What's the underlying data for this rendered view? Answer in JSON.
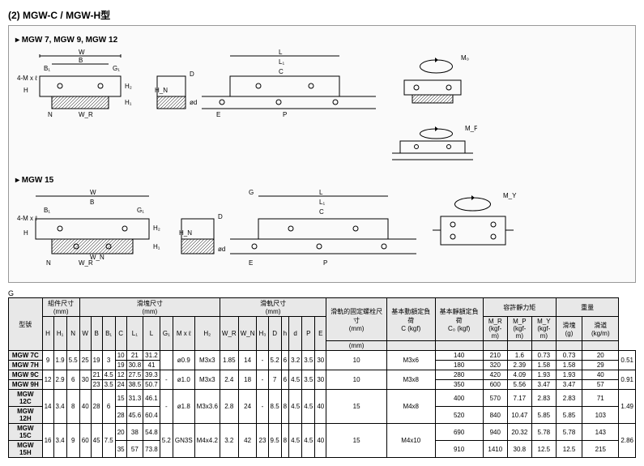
{
  "header": {
    "title": "(2) MGW-C / MGW-H型",
    "subtitle1": "▸ MGW 7, MGW 9, MGW 12",
    "subtitle2": "▸ MGW 15"
  },
  "diagram_labels": {
    "w": "W",
    "b": "B",
    "bp": "B₁",
    "gp": "G₁",
    "h": "H",
    "h2": "H₂",
    "h1": "H₁",
    "n": "N",
    "wr": "W_R",
    "wn": "W_N",
    "mxl": "4-M x ℓ",
    "l": "L",
    "l1": "L₁",
    "c": "C",
    "d": "D",
    "od": "ød",
    "g": "G",
    "hn": "H_N",
    "e": "E",
    "p": "P",
    "mo": "M₀",
    "mp": "M_P",
    "my": "M_Y"
  },
  "table": {
    "head_groups": {
      "model": "型號",
      "assy": "組件尺寸",
      "block": "滑塊尺寸",
      "rail": "滑軌尺寸",
      "bolt": "滑軌的固定螺栓尺寸",
      "dyn": "基本動額定負荷",
      "stat": "基本靜額定負荷",
      "moment": "容許靜力矩",
      "weight": "重量",
      "mm": "(mm)",
      "kgf": "(kgf)",
      "kgfm": "(kgf-m)",
      "c_dyn": "C",
      "c0": "C₀",
      "mr": "M_R",
      "mp": "M_P",
      "my": "M_Y",
      "block_g": "滑塊 (g)",
      "rail_kg": "滑道 (kg/m)"
    },
    "cols": [
      "H",
      "H₁",
      "N",
      "W",
      "B",
      "B₁",
      "C",
      "L₁",
      "L",
      "G",
      "G₁",
      "M x ℓ",
      "H₂",
      "W_R",
      "W_N",
      "H₃",
      "D",
      "h",
      "d",
      "P",
      "E"
    ],
    "rows": [
      {
        "model": "MGW 7C",
        "vals": {
          "H": "9",
          "H1": "1.9",
          "N": "5.5",
          "W": "25",
          "B": "19",
          "B1": "3",
          "C": "10",
          "L1": "21",
          "L": "31.2",
          "G": "",
          "G1": "ø0.9",
          "Mxl": "M3x3",
          "H2": "1.85",
          "WR": "14",
          "WN": "-",
          "H3": "5.2",
          "D": "6",
          "h": "3.2",
          "d": "3.5",
          "P": "30",
          "E": "10",
          "bolt": "M3x6",
          "Cdyn": "140",
          "C0": "210",
          "MR": "1.6",
          "MP": "0.73",
          "MY": "0.73",
          "wb": "20",
          "wr": "0.51"
        }
      },
      {
        "model": "MGW 7H",
        "vals": {
          "H": "",
          "H1": "",
          "N": "",
          "W": "",
          "B": "",
          "B1": "",
          "C": "19",
          "L1": "30.8",
          "L": "41",
          "G": "",
          "G1": "",
          "Mxl": "",
          "H2": "",
          "WR": "",
          "WN": "",
          "H3": "",
          "D": "",
          "h": "",
          "d": "",
          "P": "",
          "E": "",
          "bolt": "",
          "Cdyn": "180",
          "C0": "320",
          "MR": "2.39",
          "MP": "1.58",
          "MY": "1.58",
          "wb": "29",
          "wr": ""
        }
      },
      {
        "model": "MGW 9C",
        "vals": {
          "H": "12",
          "H1": "2.9",
          "N": "6",
          "W": "30",
          "B": "21",
          "B1": "4.5",
          "C": "12",
          "L1": "27.5",
          "L": "39.3",
          "G": "-",
          "G1": "ø1.0",
          "Mxl": "M3x3",
          "H2": "2.4",
          "WR": "18",
          "WN": "-",
          "H3": "7",
          "D": "6",
          "h": "4.5",
          "d": "3.5",
          "P": "30",
          "E": "10",
          "bolt": "M3x8",
          "Cdyn": "280",
          "C0": "420",
          "MR": "4.09",
          "MP": "1.93",
          "MY": "1.93",
          "wb": "40",
          "wr": "0.91"
        }
      },
      {
        "model": "MGW 9H",
        "vals": {
          "H": "",
          "H1": "",
          "N": "",
          "W": "",
          "B": "23",
          "B1": "3.5",
          "C": "24",
          "L1": "38.5",
          "L": "50.7",
          "G": "",
          "G1": "",
          "Mxl": "",
          "H2": "",
          "WR": "",
          "WN": "",
          "H3": "",
          "D": "",
          "h": "",
          "d": "",
          "P": "",
          "E": "",
          "bolt": "",
          "Cdyn": "350",
          "C0": "600",
          "MR": "5.56",
          "MP": "3.47",
          "MY": "3.47",
          "wb": "57",
          "wr": ""
        }
      },
      {
        "model": "MGW 12C",
        "vals": {
          "H": "14",
          "H1": "3.4",
          "N": "8",
          "W": "40",
          "B": "28",
          "B1": "6",
          "C": "15",
          "L1": "31.3",
          "L": "46.1",
          "G": "-",
          "G1": "ø1.8",
          "Mxl": "M3x3.6",
          "H2": "2.8",
          "WR": "24",
          "WN": "-",
          "H3": "8.5",
          "D": "8",
          "h": "4.5",
          "d": "4.5",
          "P": "40",
          "E": "15",
          "bolt": "M4x8",
          "Cdyn": "400",
          "C0": "570",
          "MR": "7.17",
          "MP": "2.83",
          "MY": "2.83",
          "wb": "71",
          "wr": "1.49"
        }
      },
      {
        "model": "MGW 12H",
        "vals": {
          "H": "",
          "H1": "",
          "N": "",
          "W": "",
          "B": "",
          "B1": "",
          "C": "28",
          "L1": "45.6",
          "L": "60.4",
          "G": "",
          "G1": "",
          "Mxl": "",
          "H2": "",
          "WR": "",
          "WN": "",
          "H3": "",
          "D": "",
          "h": "",
          "d": "",
          "P": "",
          "E": "",
          "bolt": "",
          "Cdyn": "520",
          "C0": "840",
          "MR": "10.47",
          "MP": "5.85",
          "MY": "5.85",
          "wb": "103",
          "wr": ""
        }
      },
      {
        "model": "MGW 15C",
        "vals": {
          "H": "16",
          "H1": "3.4",
          "N": "9",
          "W": "60",
          "B": "45",
          "B1": "7.5",
          "C": "20",
          "L1": "38",
          "L": "54.8",
          "G": "5.2",
          "G1": "GN3S",
          "Mxl": "M4x4.2",
          "H2": "3.2",
          "WR": "42",
          "WN": "23",
          "H3": "9.5",
          "D": "8",
          "h": "4.5",
          "d": "4.5",
          "P": "40",
          "E": "15",
          "bolt": "M4x10",
          "Cdyn": "690",
          "C0": "940",
          "MR": "20.32",
          "MP": "5.78",
          "MY": "5.78",
          "wb": "143",
          "wr": "2.86"
        }
      },
      {
        "model": "MGW 15H",
        "vals": {
          "H": "",
          "H1": "",
          "N": "",
          "W": "",
          "B": "",
          "B1": "",
          "C": "35",
          "L1": "57",
          "L": "73.8",
          "G": "",
          "G1": "",
          "Mxl": "",
          "H2": "",
          "WR": "",
          "WN": "",
          "H3": "",
          "D": "",
          "h": "",
          "d": "",
          "P": "",
          "E": "",
          "bolt": "",
          "Cdyn": "910",
          "C0": "1410",
          "MR": "30.8",
          "MP": "12.5",
          "MY": "12.5",
          "wb": "215",
          "wr": ""
        }
      }
    ]
  }
}
